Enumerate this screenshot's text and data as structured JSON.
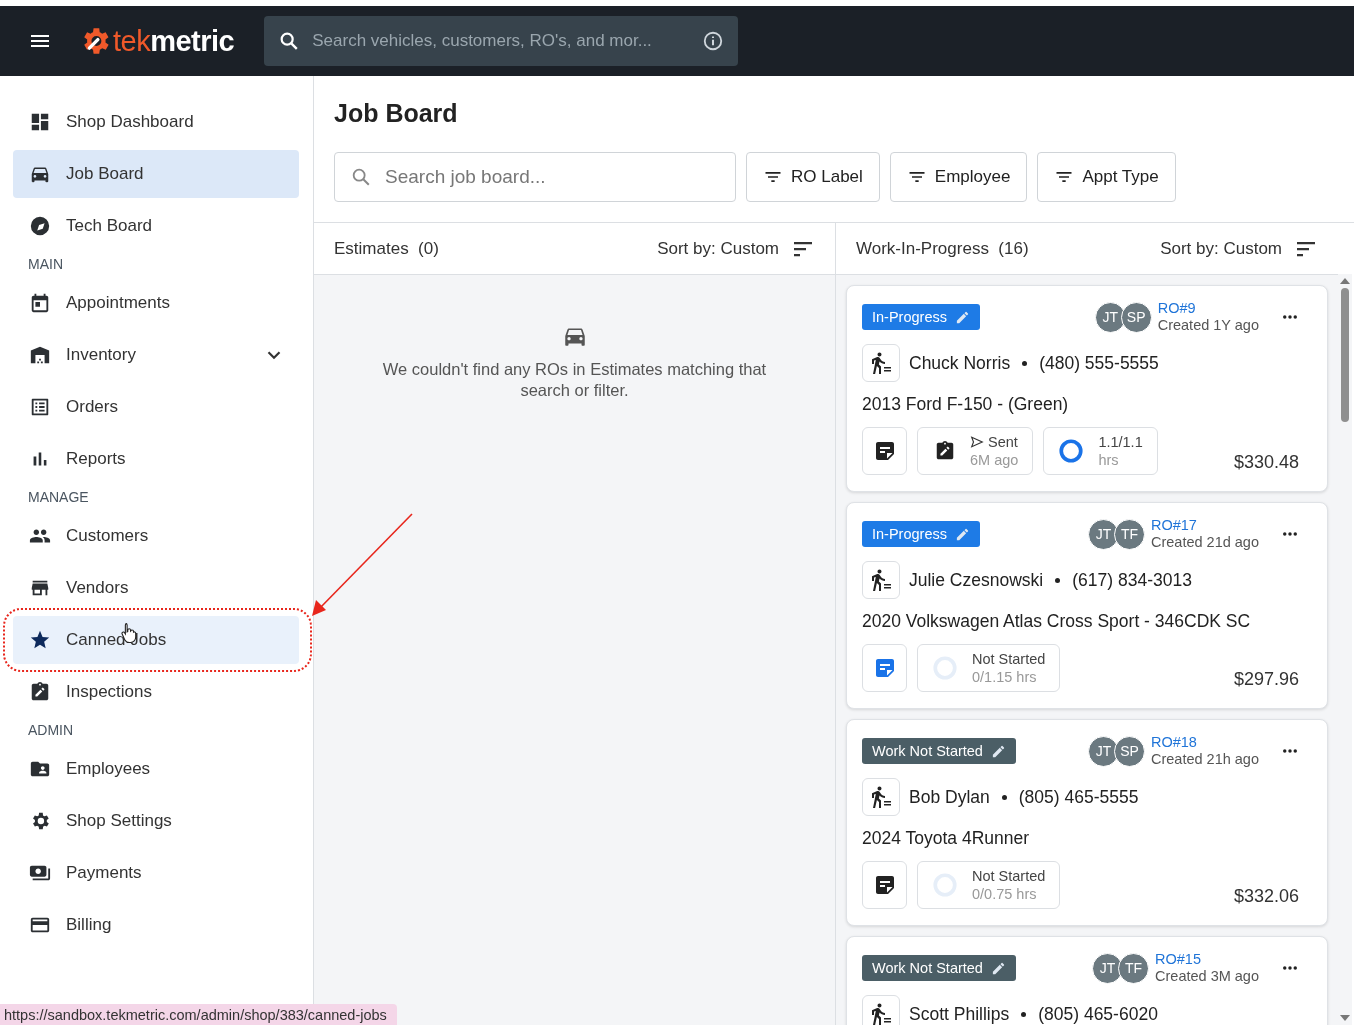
{
  "topbar": {
    "logo": {
      "accent": "tek",
      "rest": "metric"
    },
    "search": {
      "placeholder": "Search vehicles, customers, RO's, and mor..."
    }
  },
  "sidebar": {
    "entries": [
      {
        "kind": "link",
        "label": "Shop Dashboard",
        "selected": false,
        "hovered": false
      },
      {
        "kind": "link",
        "label": "Job Board",
        "selected": true,
        "hovered": false
      },
      {
        "kind": "link",
        "label": "Tech Board",
        "selected": false,
        "hovered": false
      },
      {
        "kind": "header",
        "label": "MAIN"
      },
      {
        "kind": "link",
        "label": "Appointments",
        "selected": false,
        "hovered": false
      },
      {
        "kind": "link",
        "label": "Inventory",
        "selected": false,
        "hovered": false,
        "expanded": false
      },
      {
        "kind": "link",
        "label": "Orders",
        "selected": false,
        "hovered": false
      },
      {
        "kind": "link",
        "label": "Reports",
        "selected": false,
        "hovered": false
      },
      {
        "kind": "header",
        "label": "MANAGE"
      },
      {
        "kind": "link",
        "label": "Customers",
        "selected": false,
        "hovered": false
      },
      {
        "kind": "link",
        "label": "Vendors",
        "selected": false,
        "hovered": false
      },
      {
        "kind": "link",
        "label": "Canned Jobs",
        "selected": false,
        "hovered": true,
        "annotated": true
      },
      {
        "kind": "link",
        "label": "Inspections",
        "selected": false,
        "hovered": false
      },
      {
        "kind": "header",
        "label": "ADMIN"
      },
      {
        "kind": "link",
        "label": "Employees",
        "selected": false,
        "hovered": false
      },
      {
        "kind": "link",
        "label": "Shop Settings",
        "selected": false,
        "hovered": false
      },
      {
        "kind": "link",
        "label": "Payments",
        "selected": false,
        "hovered": false
      },
      {
        "kind": "link",
        "label": "Billing",
        "selected": false,
        "hovered": false
      }
    ]
  },
  "page": {
    "title": "Job Board",
    "search": {
      "placeholder": "Search job board..."
    },
    "filters": [
      "RO Label",
      "Employee",
      "Appt Type"
    ]
  },
  "columns": [
    {
      "title": "Estimates",
      "count": "(0)",
      "sort": "Sort by: Custom",
      "empty_message": "We couldn't find any ROs in Estimates matching that search or filter."
    },
    {
      "title": "Work-In-Progress",
      "count": "(16)",
      "sort": "Sort by: Custom",
      "cards": [
        {
          "status": {
            "label": "In-Progress",
            "color": "#1e7be6"
          },
          "avatars": [
            "JT",
            "SP"
          ],
          "ro": "RO#9",
          "created": "Created 1Y ago",
          "customer": "Chuck Norris",
          "phone": "(480) 555-5555",
          "vehicle": "2013 Ford F-150 - (Green)",
          "note": {
            "color": "#222222"
          },
          "inspection": {
            "status": "Sent",
            "time": "6M ago"
          },
          "labor": {
            "hours": "1.1/1.1",
            "unit": "hrs",
            "complete": true
          },
          "total": "$330.48"
        },
        {
          "status": {
            "label": "In-Progress",
            "color": "#1e7be6"
          },
          "avatars": [
            "JT",
            "TF"
          ],
          "ro": "RO#17",
          "created": "Created 21d ago",
          "customer": "Julie Czesnowski",
          "phone": "(617) 834-3013",
          "vehicle": "2020 Volkswagen Atlas Cross Sport - 346CDK SC",
          "note": {
            "color": "#1a73e8"
          },
          "labor": {
            "hours": "Not Started",
            "unit": "0/1.15 hrs",
            "complete": false
          },
          "total": "$297.96"
        },
        {
          "status": {
            "label": "Work Not Started",
            "color": "#4b5e66"
          },
          "avatars": [
            "JT",
            "SP"
          ],
          "ro": "RO#18",
          "created": "Created 21h ago",
          "customer": "Bob Dylan",
          "phone": "(805) 465-5555",
          "vehicle": "2024 Toyota 4Runner",
          "note": {
            "color": "#222222"
          },
          "labor": {
            "hours": "Not Started",
            "unit": "0/0.75 hrs",
            "complete": false
          },
          "total": "$332.06"
        },
        {
          "status": {
            "label": "Work Not Started",
            "color": "#4b5e66"
          },
          "avatars": [
            "JT",
            "TF"
          ],
          "ro": "RO#15",
          "created": "Created 3M ago",
          "customer": "Scott Phillips",
          "phone": "(805) 465-6020"
        }
      ]
    }
  ],
  "status_url": "https://sandbox.tekmetric.com/admin/shop/383/canned-jobs"
}
